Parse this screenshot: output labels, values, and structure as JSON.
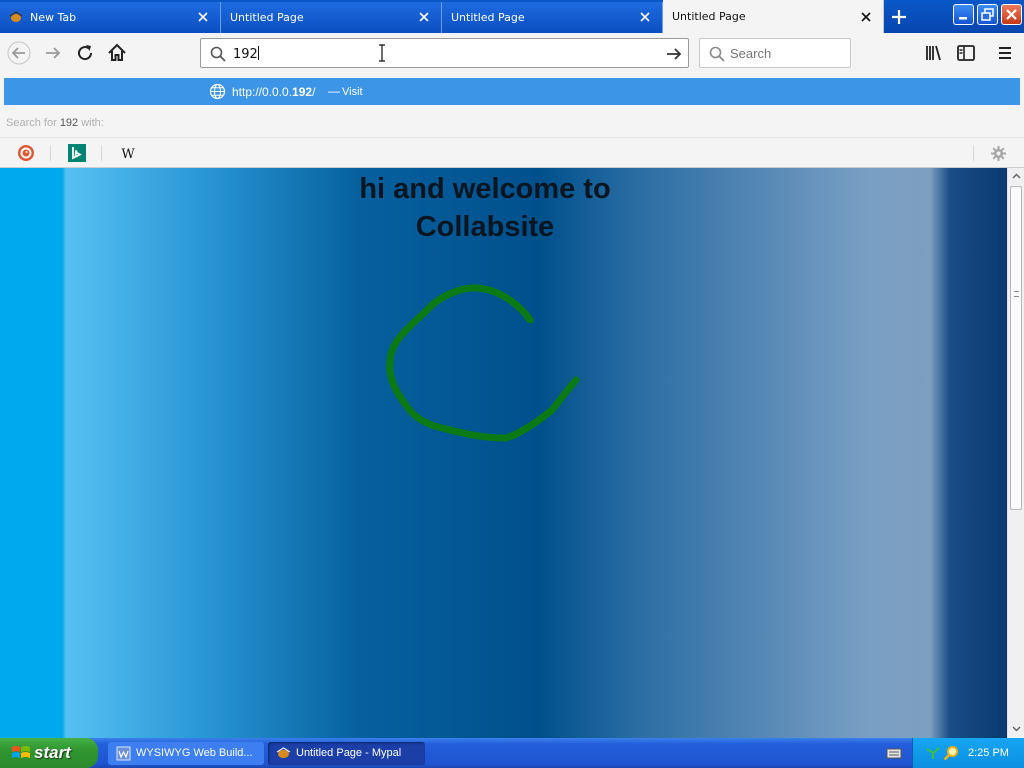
{
  "tabs": [
    {
      "label": "New Tab",
      "active": false,
      "icon": "mypal-icon"
    },
    {
      "label": "Untitled Page",
      "active": false
    },
    {
      "label": "Untitled Page",
      "active": false
    },
    {
      "label": "Untitled Page",
      "active": true
    }
  ],
  "navbar": {
    "url_value": "192",
    "search_placeholder": "Search"
  },
  "dropdown": {
    "suggestion_url_prefix": "http://0.0.0.",
    "suggestion_url_highlight": "192",
    "suggestion_url_suffix": "/",
    "suggestion_separator": "—",
    "suggestion_action": "Visit",
    "search_with_prefix": "Search for",
    "search_with_term": "192",
    "search_with_suffix": "with:",
    "engines": [
      "duckduckgo-icon",
      "bing-icon",
      "wikipedia-icon"
    ],
    "wikipedia_glyph": "W"
  },
  "page": {
    "heading_line1": "hi and welcome to",
    "heading_line2": "Collabsite",
    "drawing_color": "#0b7a14"
  },
  "taskbar": {
    "start_label": "start",
    "tasks": [
      {
        "label": "WYSIWYG Web Build...",
        "icon": "wysiwyg-app-icon",
        "active": false
      },
      {
        "label": "Untitled Page - Mypal",
        "icon": "mypal-icon",
        "active": true
      }
    ],
    "clock": "2:25 PM"
  },
  "colors": {
    "accent_blue": "#3d95e8",
    "xp_taskbar": "#245edb",
    "start_green": "#309630"
  }
}
